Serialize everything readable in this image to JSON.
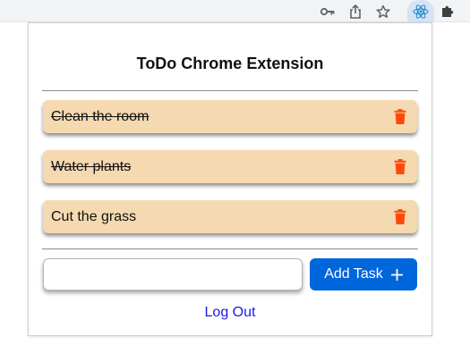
{
  "toolbar": {
    "icons": [
      "key-icon",
      "share-icon",
      "star-icon",
      "react-extension-icon",
      "puzzle-icon"
    ]
  },
  "popup": {
    "title": "ToDo Chrome Extension",
    "tasks": [
      {
        "text": "Clean the room",
        "completed": true
      },
      {
        "text": "Water plants",
        "completed": true
      },
      {
        "text": "Cut the grass",
        "completed": false
      }
    ],
    "input": {
      "value": "",
      "placeholder": ""
    },
    "add_button_label": "Add Task",
    "logout_label": "Log Out"
  },
  "colors": {
    "task_background": "#f5d9b0",
    "trash_icon": "#ff4a0a",
    "add_button": "#0066dc",
    "link": "#1a1adc"
  }
}
